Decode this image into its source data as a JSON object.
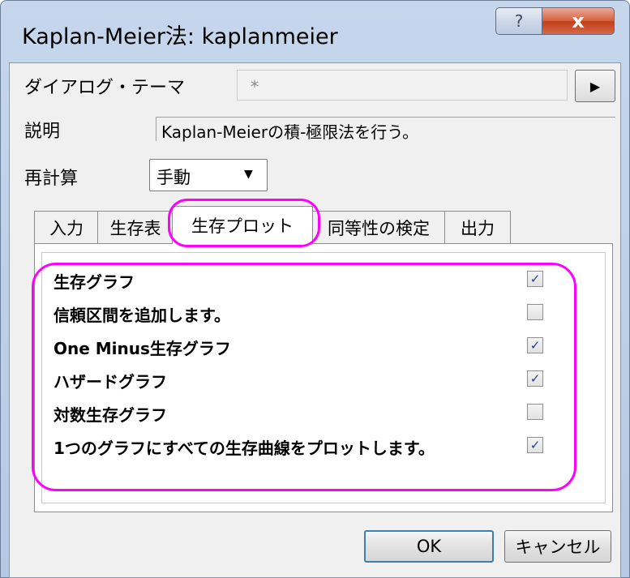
{
  "window": {
    "title": "Kaplan-Meier法: kaplanmeier",
    "help_label": "?",
    "close_label": "x"
  },
  "dialog_theme": {
    "label": "ダイアログ・テーマ",
    "value": "*",
    "arrow": "▶"
  },
  "description": {
    "label": "説明",
    "value": "Kaplan-Meierの積-極限法を行う。"
  },
  "recalc": {
    "label": "再計算",
    "value": "手動",
    "arrow": "▼"
  },
  "tabs": [
    {
      "label": "入力",
      "active": false
    },
    {
      "label": "生存表",
      "active": false
    },
    {
      "label": "生存プロット",
      "active": true
    },
    {
      "label": "同等性の検定",
      "active": false
    },
    {
      "label": "出力",
      "active": false
    }
  ],
  "options": [
    {
      "label": "生存グラフ",
      "checked": true
    },
    {
      "label": "信頼区間を追加します。",
      "checked": false
    },
    {
      "label": "One Minus生存グラフ",
      "checked": true
    },
    {
      "label": "ハザードグラフ",
      "checked": true
    },
    {
      "label": "対数生存グラフ",
      "checked": false
    },
    {
      "label": "1つのグラフにすべての生存曲線をプロットします。",
      "checked": true
    }
  ],
  "check_glyph": "✓",
  "buttons": {
    "ok": "OK",
    "cancel": "キャンセル"
  },
  "highlight_color": "#ff00ff"
}
